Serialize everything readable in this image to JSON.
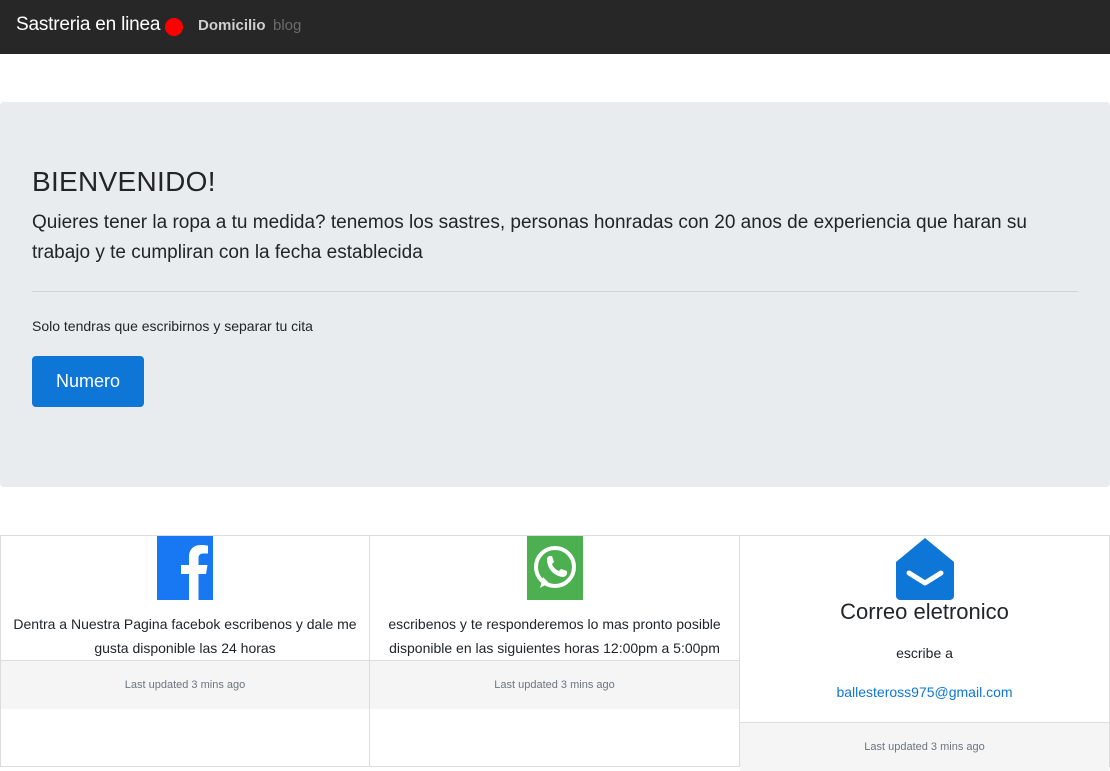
{
  "navbar": {
    "brand": "Sastreria en linea",
    "links": [
      {
        "label": "Domicilio"
      },
      {
        "label": "blog"
      }
    ],
    "brand_dot_color": "#ff0000"
  },
  "hero": {
    "title": "BIENVENIDO!",
    "lead": "Quieres tener la ropa a tu medida? tenemos los sastres, personas honradas con 20 anos de experiencia que haran su trabajo y te cumpliran con la fecha establecida",
    "text": "Solo tendras que escribirnos y separar tu cita",
    "button_label": "Numero"
  },
  "cards": [
    {
      "icon": "facebook-icon",
      "text": "Dentra a Nuestra Pagina facebok escribenos y dale me gusta disponible las 24 horas",
      "footer": "Last updated 3 mins ago"
    },
    {
      "icon": "whatsapp-icon",
      "text": "escribenos y te responderemos lo mas pronto posible disponible en las siguientes horas 12:00pm a 5:00pm",
      "footer": "Last updated 3 mins ago"
    },
    {
      "icon": "envelope-open-icon",
      "title": "Correo eletronico",
      "subtitle": "escribe a",
      "email": "ballesteross975@gmail.com",
      "footer": "Last updated 3 mins ago"
    }
  ],
  "colors": {
    "navbar_bg": "#272727",
    "primary": "#0d76d6",
    "facebook": "#1877f2",
    "whatsapp": "#4caf50",
    "jumbotron_bg": "#e9ecef"
  }
}
